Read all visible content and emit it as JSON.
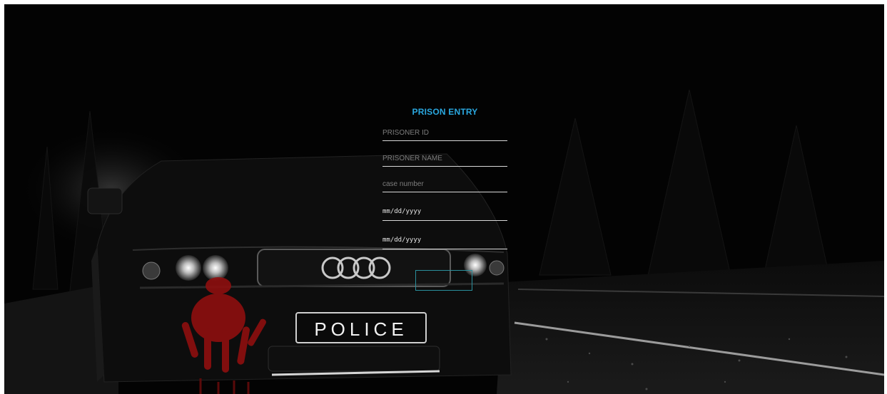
{
  "form": {
    "title": "PRISON ENTRY",
    "prisoner_id_placeholder": "PRISONER ID",
    "prisoner_name_placeholder": "PRISONER NAME",
    "case_number_placeholder": "case number",
    "date_1_value": "mm/dd/yyyy",
    "date_2_value": "mm/dd/yyyy",
    "submit_label": ""
  },
  "background": {
    "plate_text": "POLICE",
    "accent_color": "#2aa8e0",
    "button_border_color": "#2a8f9c"
  }
}
